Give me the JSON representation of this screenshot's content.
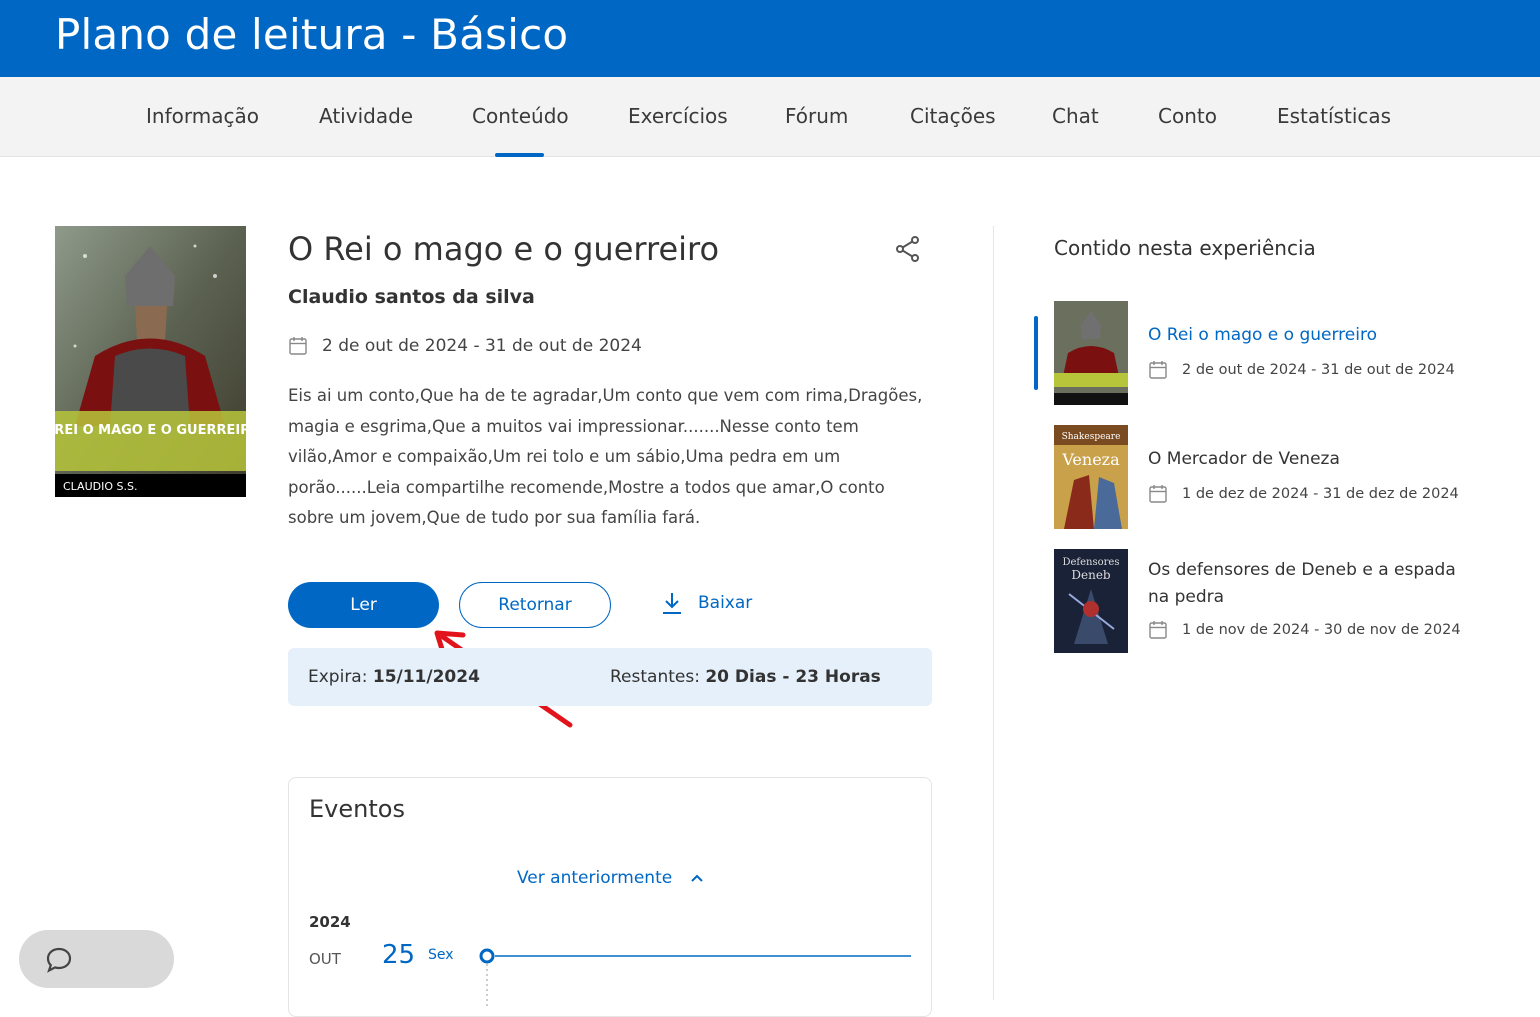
{
  "header": {
    "title": "Plano de leitura - Básico"
  },
  "tabs": [
    {
      "label": "Informação"
    },
    {
      "label": "Atividade"
    },
    {
      "label": "Conteúdo",
      "active": true
    },
    {
      "label": "Exercícios"
    },
    {
      "label": "Fórum"
    },
    {
      "label": "Citações"
    },
    {
      "label": "Chat"
    },
    {
      "label": "Conto"
    },
    {
      "label": "Estatísticas"
    }
  ],
  "book": {
    "title": "O Rei o mago e o guerreiro",
    "author": "Claudio santos da silva",
    "date_range": "2 de out de 2024 - 31 de out de 2024",
    "description": "Eis ai um conto,Que ha de te agradar,Um conto que vem com rima,Dragões, magia e esgrima,Que a muitos vai impressionar.......Nesse conto tem vilão,Amor e compaixão,Um rei tolo e um sábio,Uma pedra em um porão......Leia compartilhe recomende,Mostre a todos que amar,O conto sobre um jovem,Que de tudo por sua família fará.",
    "cover_title": "O REI O MAGO E O GUERREIRO",
    "cover_author": "CLAUDIO S.S."
  },
  "actions": {
    "read_label": "Ler",
    "return_label": "Retornar",
    "download_label": "Baixar"
  },
  "expire": {
    "label": "Expira:",
    "value": "15/11/2024",
    "remaining_label": "Restantes:",
    "remaining_value": "20 Dias - 23 Horas"
  },
  "events": {
    "title": "Eventos",
    "see_previous": "Ver anteriormente",
    "year": "2024",
    "month": "OUT",
    "day": "25",
    "weekday": "Sex"
  },
  "sidebar": {
    "title": "Contido nesta experiência",
    "items": [
      {
        "name": "O Rei o mago e o guerreiro",
        "date": "2 de out de 2024 - 31 de out de 2024",
        "active": true
      },
      {
        "name": "O Mercador de Veneza",
        "date": "1 de dez de 2024 - 31 de dez de 2024",
        "active": false,
        "cover_text_1": "Shakespeare",
        "cover_text_2": "Veneza"
      },
      {
        "name": "Os defensores de Deneb e a espada na pedra",
        "date": "1 de nov de 2024 - 30 de nov de 2024",
        "active": false,
        "cover_text_1": "Defensores",
        "cover_text_2": "Deneb"
      }
    ]
  },
  "colors": {
    "primary": "#0068c4",
    "expire_bg": "#e5f0fb",
    "annotation_arrow": "#e3131b"
  }
}
